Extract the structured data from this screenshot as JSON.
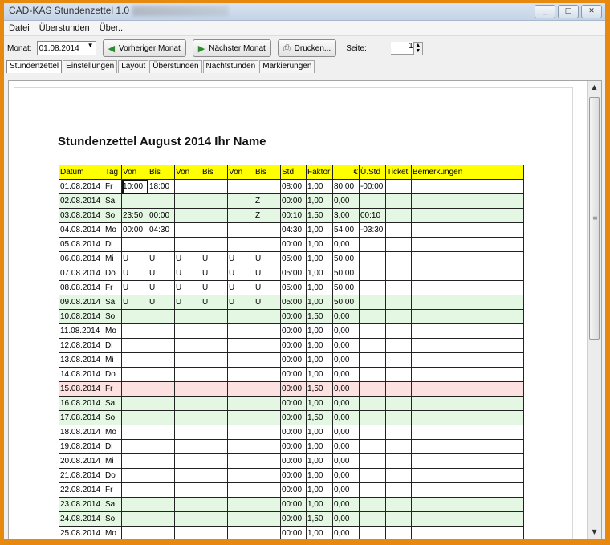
{
  "window": {
    "title": "CAD-KAS Stundenzettel 1.0",
    "controls": [
      "_",
      "□",
      "✕"
    ]
  },
  "menu": [
    "Datei",
    "Überstunden",
    "Über..."
  ],
  "toolbar": {
    "monat_label": "Monat:",
    "monat_value": "01.08.2014",
    "prev_label": "Vorheriger Monat",
    "next_label": "Nächster Monat",
    "print_label": "Drucken...",
    "seite_label": "Seite:",
    "seite_value": "1"
  },
  "tabs": [
    "Stundenzettel",
    "Einstellungen",
    "Layout",
    "Überstunden",
    "Nachtstunden",
    "Markierungen"
  ],
  "document": {
    "title": "Stundenzettel August 2014 Ihr Name",
    "headers": [
      "Datum",
      "Tag",
      "Von",
      "Bis",
      "Von",
      "Bis",
      "Von",
      "Bis",
      "Std",
      "Faktor",
      "€",
      "Ü.Std",
      "Ticket",
      "Bemerkungen"
    ],
    "rows": [
      {
        "style": "white",
        "cells": [
          "01.08.2014",
          "Fr",
          "10:00",
          "18:00",
          "",
          "",
          "",
          "",
          "08:00",
          "1,00",
          "80,00",
          "-00:00",
          "",
          ""
        ]
      },
      {
        "style": "green",
        "cells": [
          "02.08.2014",
          "Sa",
          "",
          "",
          "",
          "",
          "",
          "Z",
          "00:00",
          "1,00",
          "0,00",
          "",
          "",
          ""
        ]
      },
      {
        "style": "green",
        "cells": [
          "03.08.2014",
          "So",
          "23:50",
          "00:00",
          "",
          "",
          "",
          "Z",
          "00:10",
          "1,50",
          "3,00",
          "00:10",
          "",
          ""
        ]
      },
      {
        "style": "white",
        "cells": [
          "04.08.2014",
          "Mo",
          "00:00",
          "04:30",
          "",
          "",
          "",
          "",
          "04:30",
          "1,00",
          "54,00",
          "-03:30",
          "",
          ""
        ]
      },
      {
        "style": "white",
        "cells": [
          "05.08.2014",
          "Di",
          "",
          "",
          "",
          "",
          "",
          "",
          "00:00",
          "1,00",
          "0,00",
          "",
          "",
          ""
        ]
      },
      {
        "style": "white",
        "cells": [
          "06.08.2014",
          "Mi",
          "U",
          "U",
          "U",
          "U",
          "U",
          "U",
          "05:00",
          "1,00",
          "50,00",
          "",
          "",
          ""
        ]
      },
      {
        "style": "white",
        "cells": [
          "07.08.2014",
          "Do",
          "U",
          "U",
          "U",
          "U",
          "U",
          "U",
          "05:00",
          "1,00",
          "50,00",
          "",
          "",
          ""
        ]
      },
      {
        "style": "white",
        "cells": [
          "08.08.2014",
          "Fr",
          "U",
          "U",
          "U",
          "U",
          "U",
          "U",
          "05:00",
          "1,00",
          "50,00",
          "",
          "",
          ""
        ]
      },
      {
        "style": "green",
        "cells": [
          "09.08.2014",
          "Sa",
          "U",
          "U",
          "U",
          "U",
          "U",
          "U",
          "05:00",
          "1,00",
          "50,00",
          "",
          "",
          ""
        ]
      },
      {
        "style": "green",
        "cells": [
          "10.08.2014",
          "So",
          "",
          "",
          "",
          "",
          "",
          "",
          "00:00",
          "1,50",
          "0,00",
          "",
          "",
          ""
        ]
      },
      {
        "style": "white",
        "cells": [
          "11.08.2014",
          "Mo",
          "",
          "",
          "",
          "",
          "",
          "",
          "00:00",
          "1,00",
          "0,00",
          "",
          "",
          ""
        ]
      },
      {
        "style": "white",
        "cells": [
          "12.08.2014",
          "Di",
          "",
          "",
          "",
          "",
          "",
          "",
          "00:00",
          "1,00",
          "0,00",
          "",
          "",
          ""
        ]
      },
      {
        "style": "white",
        "cells": [
          "13.08.2014",
          "Mi",
          "",
          "",
          "",
          "",
          "",
          "",
          "00:00",
          "1,00",
          "0,00",
          "",
          "",
          ""
        ]
      },
      {
        "style": "white",
        "cells": [
          "14.08.2014",
          "Do",
          "",
          "",
          "",
          "",
          "",
          "",
          "00:00",
          "1,00",
          "0,00",
          "",
          "",
          ""
        ]
      },
      {
        "style": "red",
        "cells": [
          "15.08.2014",
          "Fr",
          "",
          "",
          "",
          "",
          "",
          "",
          "00:00",
          "1,50",
          "0,00",
          "",
          "",
          ""
        ]
      },
      {
        "style": "green",
        "cells": [
          "16.08.2014",
          "Sa",
          "",
          "",
          "",
          "",
          "",
          "",
          "00:00",
          "1,00",
          "0,00",
          "",
          "",
          ""
        ]
      },
      {
        "style": "green",
        "cells": [
          "17.08.2014",
          "So",
          "",
          "",
          "",
          "",
          "",
          "",
          "00:00",
          "1,50",
          "0,00",
          "",
          "",
          ""
        ]
      },
      {
        "style": "white",
        "cells": [
          "18.08.2014",
          "Mo",
          "",
          "",
          "",
          "",
          "",
          "",
          "00:00",
          "1,00",
          "0,00",
          "",
          "",
          ""
        ]
      },
      {
        "style": "white",
        "cells": [
          "19.08.2014",
          "Di",
          "",
          "",
          "",
          "",
          "",
          "",
          "00:00",
          "1,00",
          "0,00",
          "",
          "",
          ""
        ]
      },
      {
        "style": "white",
        "cells": [
          "20.08.2014",
          "Mi",
          "",
          "",
          "",
          "",
          "",
          "",
          "00:00",
          "1,00",
          "0,00",
          "",
          "",
          ""
        ]
      },
      {
        "style": "white",
        "cells": [
          "21.08.2014",
          "Do",
          "",
          "",
          "",
          "",
          "",
          "",
          "00:00",
          "1,00",
          "0,00",
          "",
          "",
          ""
        ]
      },
      {
        "style": "white",
        "cells": [
          "22.08.2014",
          "Fr",
          "",
          "",
          "",
          "",
          "",
          "",
          "00:00",
          "1,00",
          "0,00",
          "",
          "",
          ""
        ]
      },
      {
        "style": "green",
        "cells": [
          "23.08.2014",
          "Sa",
          "",
          "",
          "",
          "",
          "",
          "",
          "00:00",
          "1,00",
          "0,00",
          "",
          "",
          ""
        ]
      },
      {
        "style": "green",
        "cells": [
          "24.08.2014",
          "So",
          "",
          "",
          "",
          "",
          "",
          "",
          "00:00",
          "1,50",
          "0,00",
          "",
          "",
          ""
        ]
      },
      {
        "style": "white",
        "cells": [
          "25.08.2014",
          "Mo",
          "",
          "",
          "",
          "",
          "",
          "",
          "00:00",
          "1,00",
          "0,00",
          "",
          "",
          ""
        ]
      }
    ]
  },
  "colors": {
    "header_fill": "#ffff00",
    "weekend_fill": "#e3f7e3",
    "holiday_fill": "#fde0e0",
    "frame": "#e8890f"
  }
}
